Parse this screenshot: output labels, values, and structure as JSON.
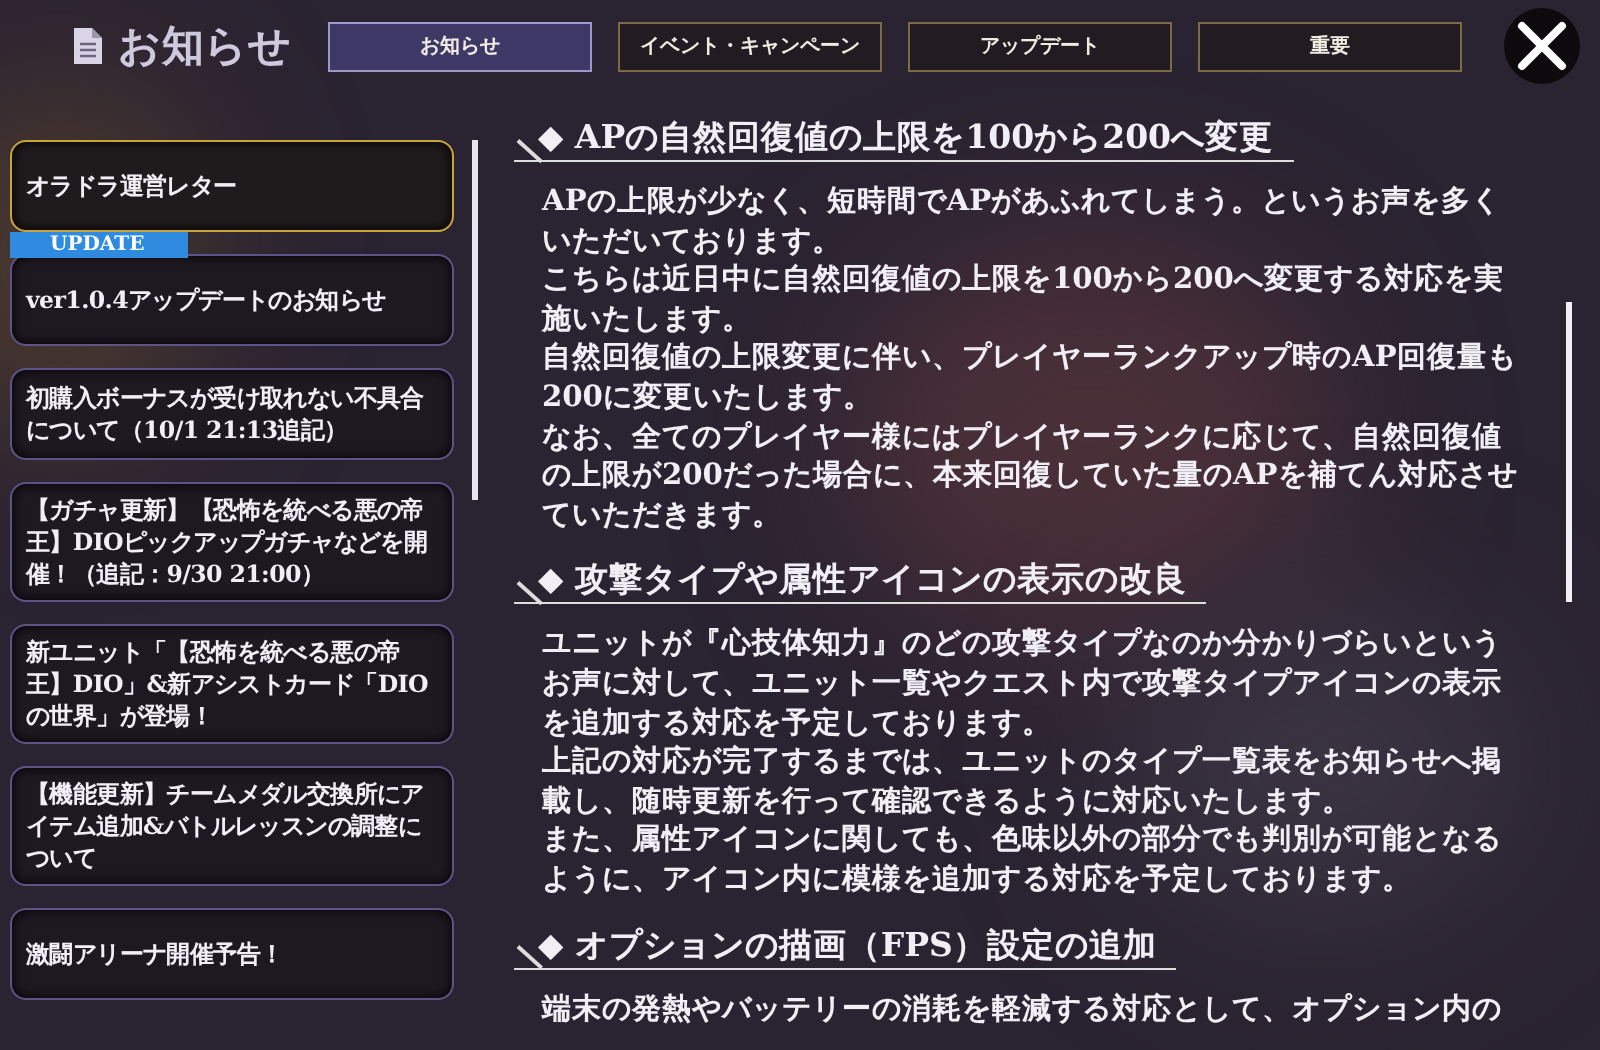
{
  "header": {
    "title": "お知らせ"
  },
  "tabs": [
    {
      "label": "お知らせ",
      "selected": true
    },
    {
      "label": "イベント・キャンペーン",
      "selected": false
    },
    {
      "label": "アップデート",
      "selected": false
    },
    {
      "label": "重要",
      "selected": false
    }
  ],
  "sidebar": {
    "items": [
      {
        "title": "オラドラ運営レター",
        "selected": true
      },
      {
        "title": "ver1.0.4アップデートのお知らせ",
        "selected": false,
        "badge": "UPDATE"
      },
      {
        "title": "初購入ボーナスが受け取れない不具合について（10/1 21:13追記）",
        "selected": false
      },
      {
        "title": "【ガチャ更新】【恐怖を統べる悪の帝王】DIOピックアップガチャなどを開催！（追記：9/30 21:00）",
        "selected": false
      },
      {
        "title": "新ユニット「【恐怖を統べる悪の帝王】DIO」&新アシストカード「DIOの世界」が登場！",
        "selected": false
      },
      {
        "title": "【機能更新】チームメダル交換所にアイテム追加&バトルレッスンの調整について",
        "selected": false
      },
      {
        "title": "激闘アリーナ開催予告！",
        "selected": false
      }
    ]
  },
  "article": {
    "sections": [
      {
        "heading": "◆ APの自然回復値の上限を100から200へ変更",
        "paragraphs": [
          "APの上限が少なく、短時間でAPがあふれてしまう。というお声を多くいただいております。",
          "こちらは近日中に自然回復値の上限を100から200へ変更する対応を実施いたします。",
          "自然回復値の上限変更に伴い、プレイヤーランクアップ時のAP回復量も200に変更いたします。",
          "なお、全てのプレイヤー様にはプレイヤーランクに応じて、自然回復値の上限が200だった場合に、本来回復していた量のAPを補てん対応させていただきます。"
        ]
      },
      {
        "heading": "◆ 攻撃タイプや属性アイコンの表示の改良",
        "paragraphs": [
          "ユニットが『心技体知力』のどの攻撃タイプなのか分かりづらいというお声に対して、ユニット一覧やクエスト内で攻撃タイプアイコンの表示を追加する対応を予定しております。",
          "上記の対応が完了するまでは、ユニットのタイプ一覧表をお知らせへ掲載し、随時更新を行って確認できるように対応いたします。",
          "また、属性アイコンに関しても、色味以外の部分でも判別が可能となるように、アイコン内に模様を追加する対応を予定しております。"
        ]
      },
      {
        "heading": "◆ オプションの描画（FPS）設定の追加",
        "paragraphs": [
          "端末の発熱やバッテリーの消耗を軽減する対応として、オプション内の"
        ]
      }
    ]
  }
}
